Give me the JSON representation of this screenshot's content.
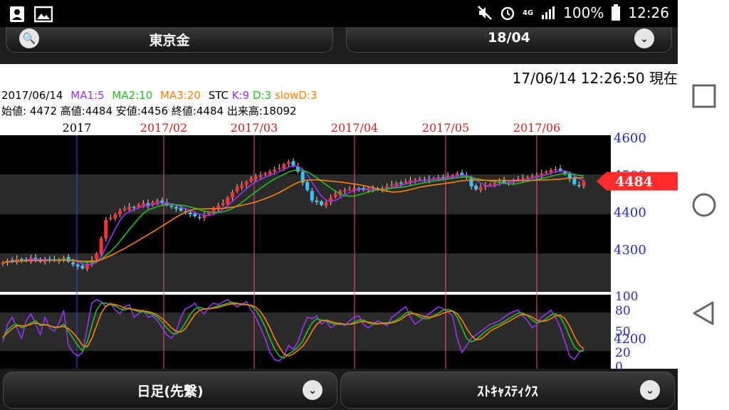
{
  "status_bar": {
    "battery": "100%",
    "time": "12:26",
    "network": "4G"
  },
  "header": {
    "market": "東京金",
    "contract": "18/04"
  },
  "timestamp": "17/06/14 12:26:50 現在",
  "indicators": {
    "date": "2017/06/14",
    "ma1": "MA1:5",
    "ma2": "MA2:10",
    "ma3": "MA3:20",
    "stc": "STC",
    "k": "K:9",
    "d": "D:3",
    "slowd": "slowD:3",
    "colors": {
      "ma1": "#9b30ff",
      "ma2": "#20c020",
      "ma3": "#ff7f00"
    }
  },
  "ohlc": {
    "open": "始値: 4472",
    "high": "高値:4484",
    "low": "安値:4456",
    "close": "終値:4484",
    "volume": "出来高:18092"
  },
  "bottom": {
    "period": "日足(先繋)",
    "indicator": "ｽﾄｷｬｽﾃｨｸｽ"
  },
  "chart_data": [
    {
      "type": "candlestick",
      "months": [
        "2017",
        "2017/02",
        "2017/03",
        "2017/04",
        "2017/05",
        "2017/06"
      ],
      "y_ticks": [
        "4600",
        "4500",
        "4400",
        "4300",
        "4200"
      ],
      "ylim": [
        4200,
        4600
      ],
      "current_price": "4484",
      "closes": [
        4265,
        4270,
        4268,
        4275,
        4272,
        4270,
        4278,
        4273,
        4268,
        4275,
        4272,
        4270,
        4274,
        4278,
        4268,
        4260,
        4255,
        4250,
        4262,
        4272,
        4290,
        4330,
        4380,
        4385,
        4395,
        4405,
        4410,
        4415,
        4412,
        4420,
        4425,
        4418,
        4428,
        4432,
        4425,
        4420,
        4415,
        4410,
        4405,
        4400,
        4395,
        4390,
        4385,
        4392,
        4400,
        4410,
        4418,
        4425,
        4440,
        4455,
        4468,
        4474,
        4482,
        4492,
        4496,
        4500,
        4505,
        4510,
        4515,
        4520,
        4530,
        4536,
        4525,
        4510,
        4480,
        4460,
        4432,
        4428,
        4420,
        4428,
        4440,
        4450,
        4458,
        4460,
        4462,
        4465,
        4464,
        4460,
        4462,
        4463,
        4462,
        4465,
        4470,
        4475,
        4480,
        4478,
        4482,
        4486,
        4488,
        4490,
        4486,
        4490,
        4492,
        4495,
        4494,
        4498,
        4500,
        4505,
        4500,
        4495,
        4470,
        4462,
        4468,
        4472,
        4476,
        4480,
        4484,
        4480,
        4482,
        4486,
        4490,
        4492,
        4495,
        4498,
        4500,
        4505,
        4510,
        4514,
        4516,
        4512,
        4505,
        4490,
        4476,
        4472,
        4484
      ],
      "series": [
        {
          "name": "MA1:5"
        },
        {
          "name": "MA2:10"
        },
        {
          "name": "MA3:20"
        }
      ]
    },
    {
      "type": "line",
      "y_ticks": [
        "100",
        "80",
        "50",
        "20",
        "0"
      ],
      "ylim": [
        0,
        100
      ],
      "k": [
        35,
        60,
        70,
        55,
        40,
        65,
        75,
        60,
        45,
        70,
        55,
        50,
        62,
        80,
        30,
        20,
        15,
        20,
        55,
        90,
        95,
        92,
        85,
        90,
        80,
        75,
        85,
        88,
        70,
        75,
        80,
        70,
        72,
        65,
        55,
        45,
        40,
        50,
        70,
        82,
        85,
        90,
        80,
        75,
        85,
        90,
        88,
        92,
        95,
        90,
        85,
        88,
        92,
        80,
        70,
        55,
        40,
        20,
        10,
        8,
        15,
        30,
        25,
        35,
        55,
        70,
        68,
        72,
        60,
        65,
        55,
        60,
        62,
        58,
        65,
        70,
        72,
        60,
        55,
        60,
        65,
        62,
        58,
        70,
        75,
        80,
        85,
        70,
        60,
        65,
        70,
        75,
        80,
        85,
        82,
        78,
        72,
        40,
        20,
        30,
        40,
        45,
        50,
        55,
        60,
        62,
        65,
        70,
        75,
        78,
        80,
        72,
        65,
        55,
        60,
        70,
        75,
        80,
        70,
        55,
        35,
        15,
        10,
        20,
        25
      ],
      "d": [
        40,
        52,
        58,
        60,
        55,
        58,
        62,
        65,
        58,
        60,
        58,
        55,
        56,
        60,
        50,
        40,
        30,
        22,
        35,
        58,
        80,
        90,
        90,
        88,
        86,
        82,
        80,
        83,
        80,
        78,
        78,
        76,
        74,
        70,
        63,
        55,
        48,
        46,
        52,
        62,
        74,
        82,
        84,
        82,
        82,
        84,
        86,
        88,
        90,
        91,
        90,
        88,
        88,
        86,
        80,
        70,
        56,
        40,
        25,
        15,
        12,
        18,
        22,
        28,
        36,
        50,
        62,
        68,
        66,
        65,
        62,
        60,
        60,
        60,
        60,
        63,
        66,
        66,
        62,
        60,
        60,
        62,
        62,
        63,
        66,
        70,
        76,
        78,
        74,
        70,
        68,
        68,
        72,
        76,
        80,
        81,
        79,
        70,
        55,
        40,
        35,
        38,
        44,
        50,
        54,
        58,
        60,
        64,
        68,
        72,
        76,
        76,
        72,
        66,
        62,
        64,
        68,
        73,
        75,
        70,
        58,
        42,
        28,
        22,
        22
      ],
      "slowd": [
        42,
        48,
        54,
        58,
        58,
        58,
        60,
        62,
        60,
        59,
        58,
        56,
        56,
        57,
        54,
        48,
        40,
        30,
        28,
        40,
        58,
        76,
        86,
        89,
        88,
        86,
        83,
        82,
        81,
        80,
        79,
        78,
        76,
        73,
        68,
        62,
        55,
        50,
        49,
        54,
        64,
        74,
        80,
        82,
        82,
        83,
        84,
        86,
        88,
        89,
        89,
        89,
        88,
        87,
        84,
        78,
        68,
        55,
        40,
        28,
        18,
        15,
        18,
        23,
        29,
        38,
        50,
        60,
        65,
        66,
        64,
        62,
        61,
        60,
        60,
        61,
        63,
        64,
        63,
        62,
        61,
        61,
        61,
        62,
        64,
        67,
        72,
        75,
        75,
        73,
        71,
        70,
        71,
        73,
        76,
        78,
        79,
        75,
        66,
        54,
        44,
        38,
        39,
        44,
        50,
        54,
        57,
        61,
        64,
        68,
        72,
        74,
        73,
        70,
        66,
        64,
        65,
        68,
        72,
        73,
        68,
        57,
        43,
        31,
        25
      ]
    }
  ]
}
